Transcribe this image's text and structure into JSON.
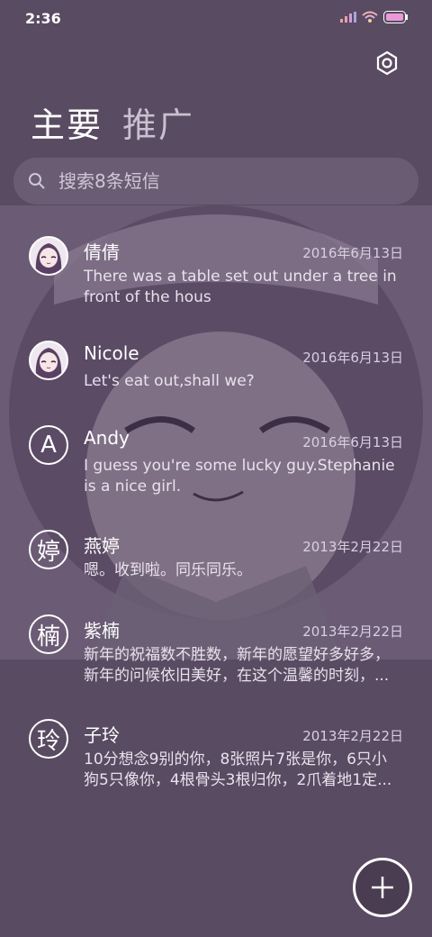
{
  "status": {
    "time": "2:36"
  },
  "tabs": [
    {
      "label": "主要",
      "active": true
    },
    {
      "label": "推广",
      "active": false
    }
  ],
  "search": {
    "placeholder": "搜索8条短信"
  },
  "conversations": [
    {
      "name": "倩倩",
      "date": "2016年6月13日",
      "snippet": "There was a table set out under a tree in front of the hous",
      "avatar_type": "picture"
    },
    {
      "name": "Nicole",
      "date": "2016年6月13日",
      "snippet": "Let's eat out,shall we?",
      "avatar_type": "picture"
    },
    {
      "name": "Andy",
      "date": "2016年6月13日",
      "snippet": "I guess you're some lucky guy.Stephanie is a nice girl.",
      "avatar_type": "letter",
      "avatar_letter": "A"
    },
    {
      "name": "燕婷",
      "date": "2013年2月22日",
      "snippet": "嗯。收到啦。同乐同乐。",
      "avatar_type": "letter",
      "avatar_letter": "婷"
    },
    {
      "name": "紫楠",
      "date": "2013年2月22日",
      "snippet": "新年的祝福数不胜数，新年的愿望好多好多，新年的问候依旧美好，在这个温馨的时刻，...",
      "avatar_type": "letter",
      "avatar_letter": "楠"
    },
    {
      "name": "子玲",
      "date": "2013年2月22日",
      "snippet": "10分想念9别的你，8张照片7张是你，6只小狗5只像你，4根骨头3根归你，2爪着地1定...",
      "avatar_type": "letter",
      "avatar_letter": "玲"
    }
  ],
  "icons": {
    "settings": "gear-icon",
    "search": "search-icon",
    "compose": "plus-icon"
  },
  "colors": {
    "background": "#594b62",
    "search_bg": "#6a5c72"
  }
}
